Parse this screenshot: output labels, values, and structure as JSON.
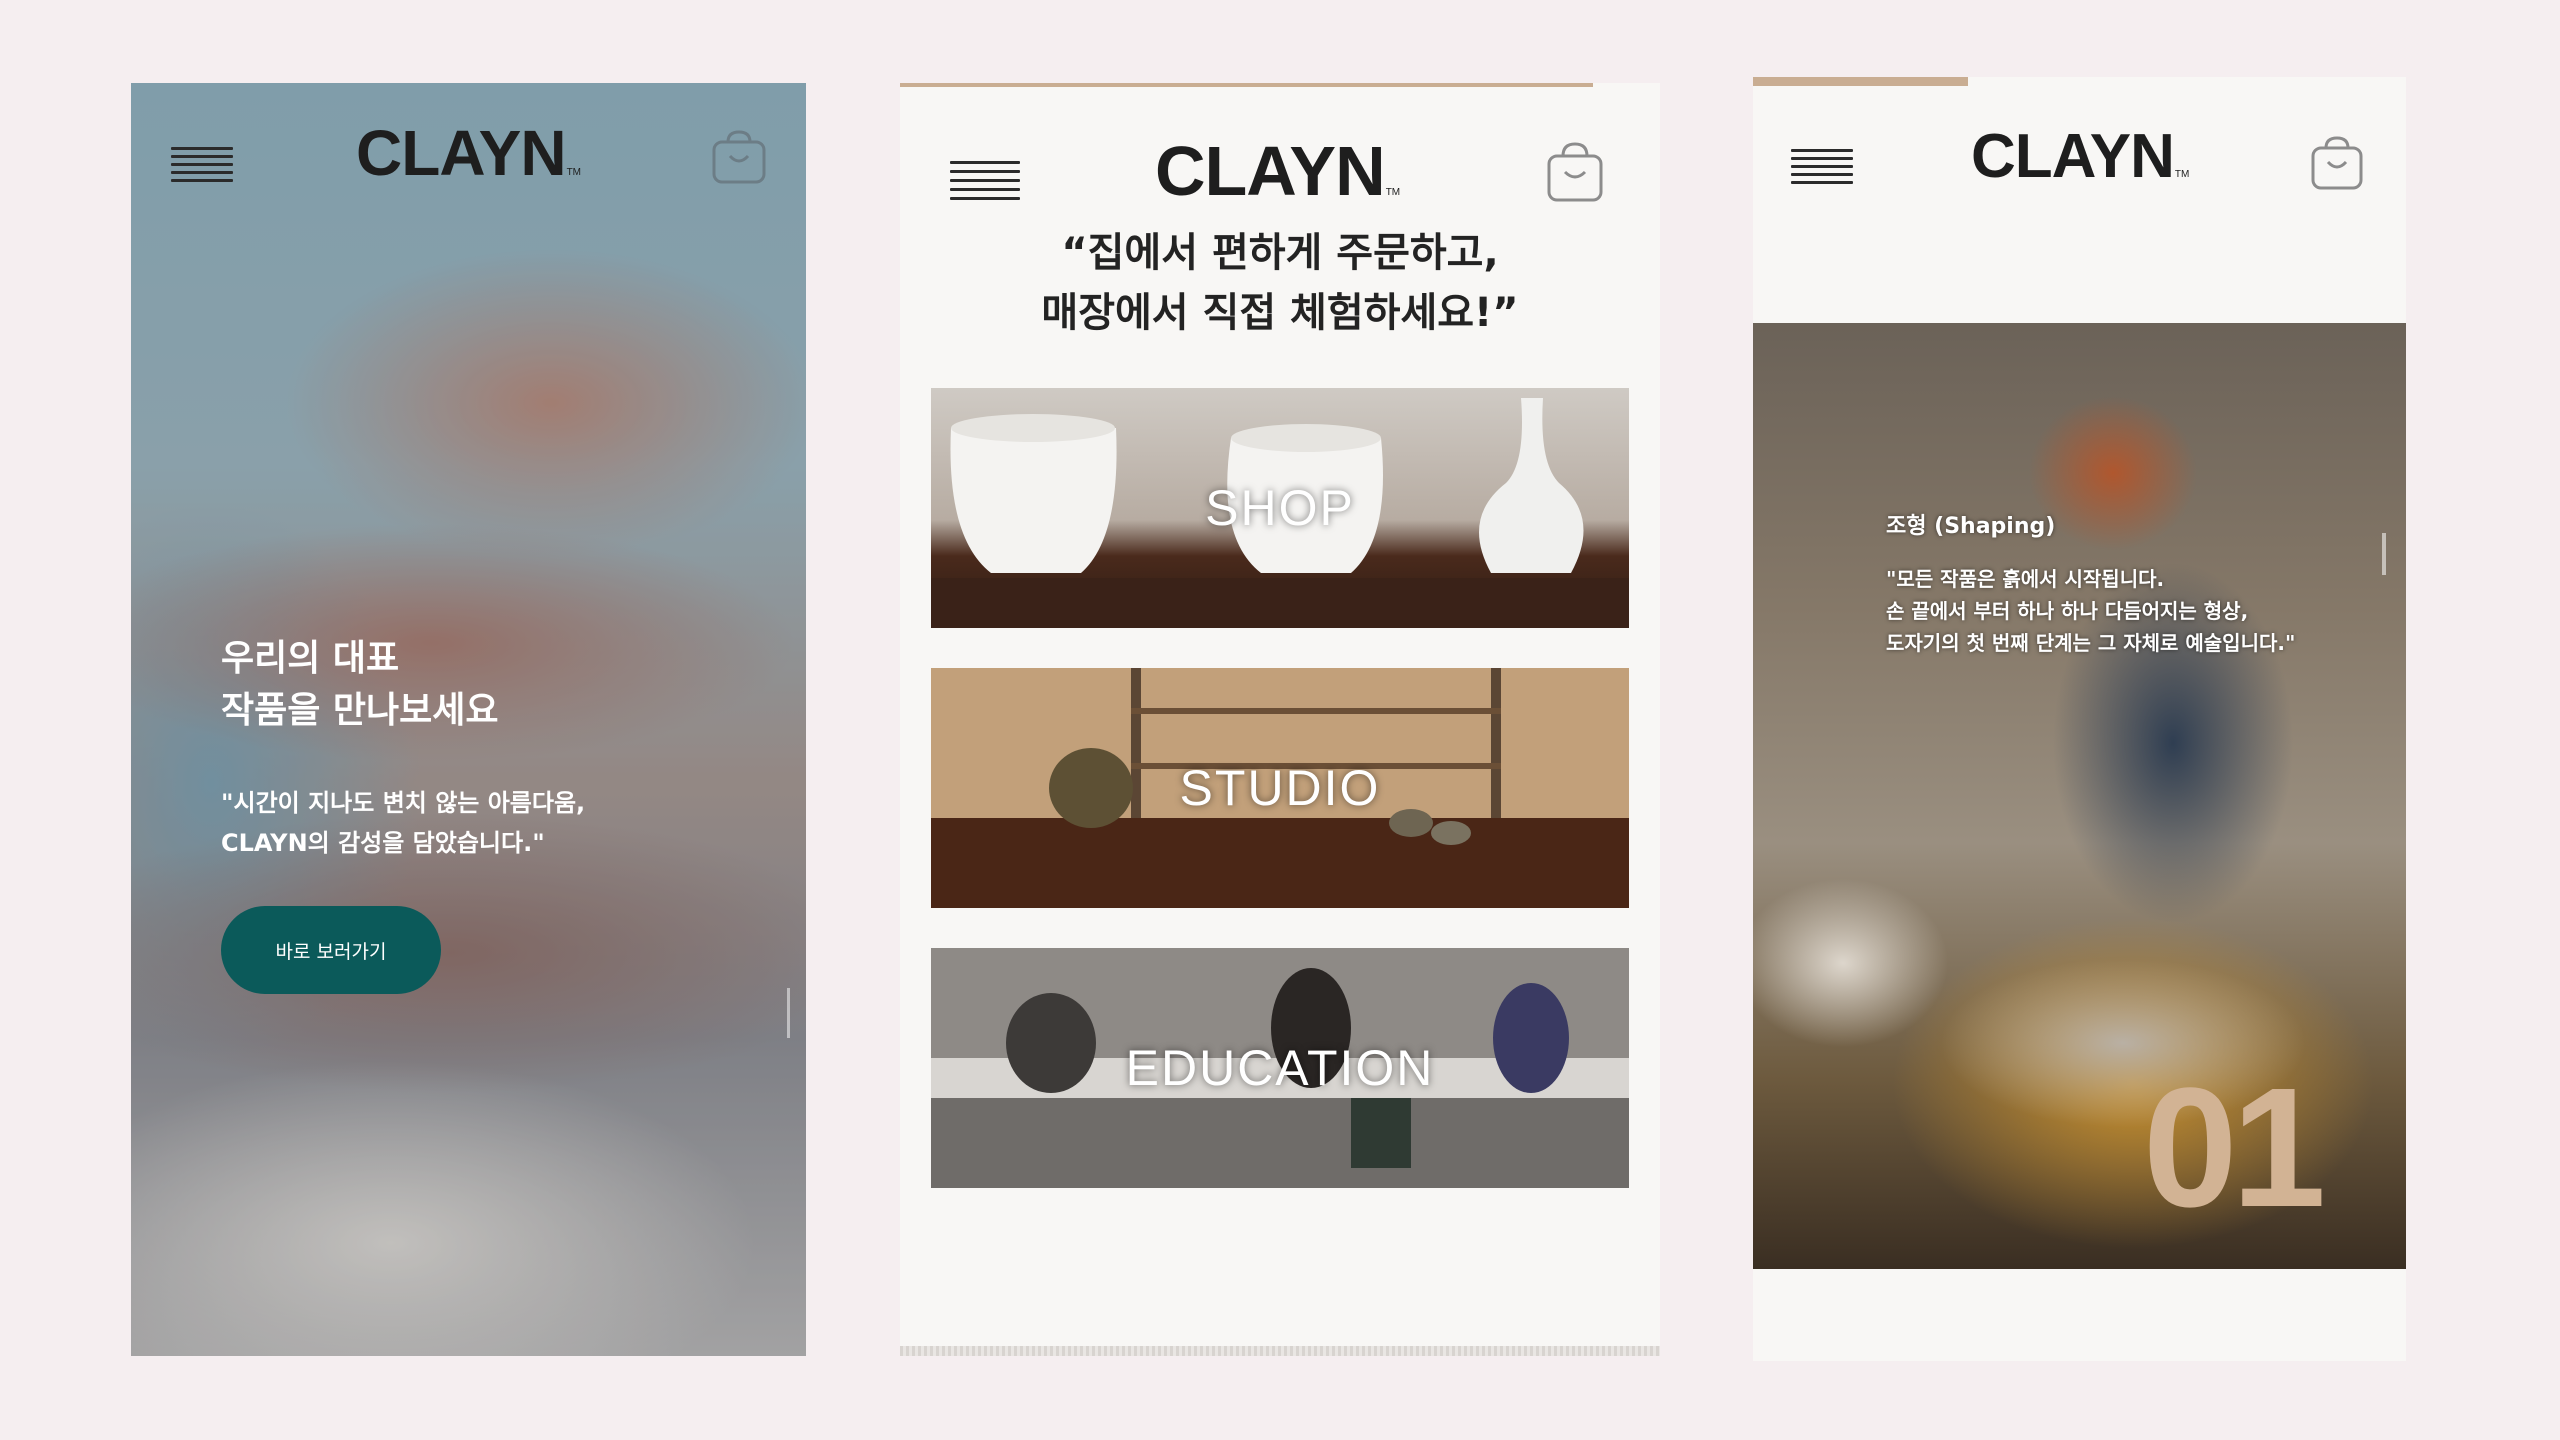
{
  "brand": "CLAYN",
  "brand_tm": "TM",
  "phone1": {
    "hero_title_line1": "우리의 대표",
    "hero_title_line2": "작품을 만나보세요",
    "hero_quote_line1": "\"시간이 지나도 변치 않는 아름다움,",
    "hero_quote_line2": "CLAYN의 감성을 담았습니다.\"",
    "cta_label": "바로 보러가기"
  },
  "phone2": {
    "headline_line1": "“집에서 편하게 주문하고,",
    "headline_line2": "매장에서 직접 체험하세요!”",
    "categories": [
      {
        "label": "SHOP"
      },
      {
        "label": "STUDIO"
      },
      {
        "label": "EDUCATION"
      }
    ]
  },
  "phone3": {
    "step_title": "조형 (Shaping)",
    "step_text_line1": "\"모든 작품은 흙에서 시작됩니다.",
    "step_text_line2": "손 끝에서 부터 하나 하나 다듬어지는 형상,",
    "step_text_line3": "도자기의 첫 번째 단계는 그 자체로 예술입니다.\"",
    "step_number": "01"
  },
  "colors": {
    "background": "#f5eef0",
    "accent_teal": "#0b5a5a",
    "accent_tan": "#c9ad92",
    "text_dark": "#1e1e1e"
  },
  "icons": [
    "hamburger-menu-icon",
    "shopping-bag-icon"
  ]
}
